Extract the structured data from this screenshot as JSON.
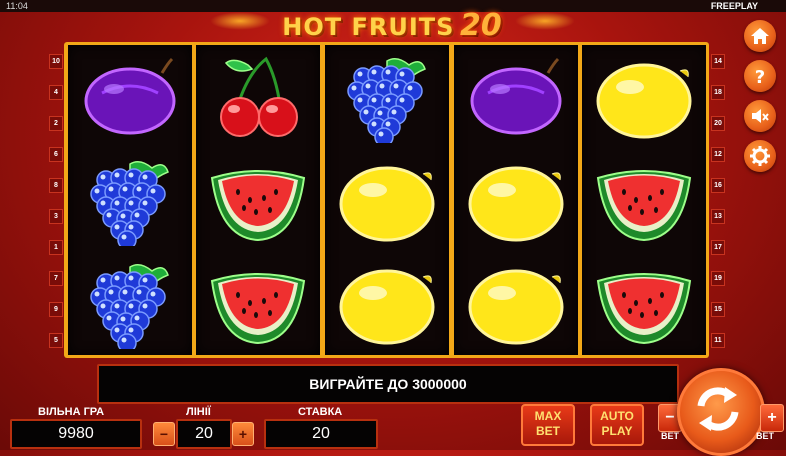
{
  "status": {
    "clock": "11:04",
    "mode": "FREEPLAY"
  },
  "logo": {
    "title": "HOT FRUITS",
    "number": "20"
  },
  "reels": [
    [
      "plum",
      "grapes",
      "grapes"
    ],
    [
      "cherry",
      "watermelon",
      "watermelon"
    ],
    [
      "grapes",
      "lemon",
      "lemon"
    ],
    [
      "plum",
      "lemon",
      "lemon"
    ],
    [
      "lemon",
      "watermelon",
      "watermelon"
    ]
  ],
  "paylines_left": [
    "10",
    "4",
    "2",
    "6",
    "8",
    "3",
    "1",
    "7",
    "9",
    "5"
  ],
  "paylines_right": [
    "14",
    "18",
    "20",
    "12",
    "16",
    "13",
    "17",
    "19",
    "15",
    "11"
  ],
  "side_buttons": [
    "home-icon",
    "help-icon",
    "sound-muted-icon",
    "settings-icon"
  ],
  "message": "ВИГРАЙТЕ ДО 3000000",
  "balance": {
    "label": "ВІЛЬНА ГРА",
    "value": "9980"
  },
  "lines": {
    "label": "ЛІНІЇ",
    "value": "20",
    "minus": "−",
    "plus": "+"
  },
  "stake": {
    "label": "СТАВКА",
    "value": "20"
  },
  "max_bet": {
    "line1": "MAX",
    "line2": "BET"
  },
  "auto_play": {
    "line1": "AUTO",
    "line2": "PLAY"
  },
  "bet_minus": {
    "symbol": "−",
    "caption": "BET"
  },
  "bet_plus": {
    "symbol": "+",
    "caption": "BET"
  },
  "colors": {
    "frame": "#f2a818",
    "accent": "#e8601a",
    "background": "#a8140e"
  }
}
